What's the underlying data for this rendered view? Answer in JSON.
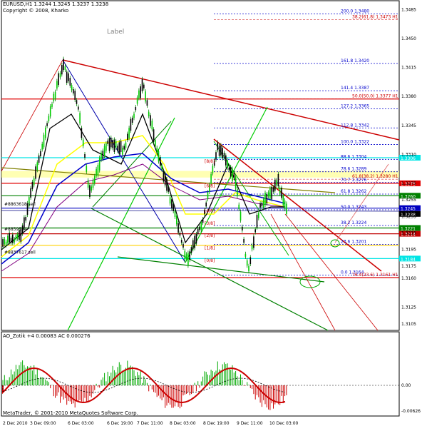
{
  "header": {
    "symbol_line": "EURUSD,H1  1.3244 1.3245 1.3237 1.3238",
    "copyright": "Copyright © 2008, Kharko"
  },
  "label": "Label",
  "fib_levels": [
    {
      "label": "200.0  1.3480",
      "price": 1.348,
      "color": "#0000cc"
    },
    {
      "label": "161.8  1.3420",
      "price": 1.342,
      "color": "#0000cc"
    },
    {
      "label": "141.4  1.3387",
      "price": 1.3387,
      "color": "#0000cc"
    },
    {
      "label": "127.2  1.3365",
      "price": 1.3365,
      "color": "#0000cc"
    },
    {
      "label": "112.8  1.3342",
      "price": 1.3342,
      "color": "#0000cc"
    },
    {
      "label": "100.0  1.3322",
      "price": 1.3322,
      "color": "#0000cc"
    },
    {
      "label": "88.6  1.3304",
      "price": 1.3304,
      "color": "#0000cc"
    },
    {
      "label": "78.6  1.3289",
      "price": 1.3289,
      "color": "#0000cc"
    },
    {
      "label": "70.7  1.3276",
      "price": 1.3276,
      "color": "#0000cc"
    },
    {
      "label": "61.8  1.3262",
      "price": 1.3262,
      "color": "#0000cc"
    },
    {
      "label": "50.0  1.3243",
      "price": 1.3243,
      "color": "#0000cc"
    },
    {
      "label": "38.2  1.3224",
      "price": 1.3224,
      "color": "#0000cc"
    },
    {
      "label": "23.6  1.3201",
      "price": 1.3201,
      "color": "#0000cc"
    },
    {
      "label": "0.0  1.3164",
      "price": 1.3164,
      "color": "#0000cc"
    }
  ],
  "red_fib_labels": [
    {
      "label": "38.2(61.8)  1.3473 H1",
      "price": 1.3473
    },
    {
      "label": "50.0(50.0)  1.3377 H1",
      "price": 1.3377
    },
    {
      "label": "61.8(38.2)  1.3280 H1",
      "price": 1.328
    },
    {
      "label": "76.4(23.6)  1.3161 H1",
      "price": 1.3161
    }
  ],
  "right_price_boxes": [
    {
      "text": "1.3306",
      "price": 1.3306,
      "bg": "#00e5e5",
      "fg": "#ffffff"
    },
    {
      "text": "1.3275",
      "price": 1.3275,
      "bg": "#e00000",
      "fg": "#ffffff"
    },
    {
      "text": "1.3260",
      "price": 1.326,
      "bg": "#008000",
      "fg": "#ffffff"
    },
    {
      "text": "1.3245",
      "price": 1.3245,
      "bg": "#0000c0",
      "fg": "#ffffff"
    },
    {
      "text": "1.3238",
      "price": 1.3238,
      "bg": "#000000",
      "fg": "#ffffff"
    },
    {
      "text": "1.3221",
      "price": 1.3221,
      "bg": "#008000",
      "fg": "#ffffff"
    },
    {
      "text": "1.3214",
      "price": 1.3214,
      "bg": "#c00000",
      "fg": "#ffffff"
    },
    {
      "text": "1.3184",
      "price": 1.3184,
      "bg": "#00e5e5",
      "fg": "#ffffff"
    }
  ],
  "price_axis": [
    "1.3485",
    "1.3450",
    "1.3415",
    "1.3380",
    "1.3345",
    "1.3310",
    "1.3275",
    "1.3255",
    "1.3235",
    "1.3215",
    "1.3195",
    "1.3175",
    "1.3160",
    "1.3125",
    "1.3105"
  ],
  "trade_labels": [
    {
      "text": "#8863618 sell",
      "price": 1.3248
    },
    {
      "text": "#8859594",
      "price": 1.3218
    },
    {
      "text": "#8837617 sell",
      "price": 1.319
    }
  ],
  "octave_labels": [
    {
      "text": "[8/8]",
      "price": 1.33
    },
    {
      "text": "[6/8]",
      "price": 1.327
    },
    {
      "text": "[4/8]",
      "price": 1.324
    },
    {
      "text": "[3/8]",
      "price": 1.3225
    },
    {
      "text": "[2/8]",
      "price": 1.321
    },
    {
      "text": "[1/8]",
      "price": 1.3195
    },
    {
      "text": "[0/8]",
      "price": 1.318
    }
  ],
  "indicator": {
    "title": "AO_Zotik +4  0.00083  AC  0.000276",
    "axis": [
      "0.00",
      "-0.00626"
    ]
  },
  "time_axis": [
    "2 Dec 2010",
    "3 Dec 09:00",
    "6 Dec 03:00",
    "6 Dec 19:00",
    "7 Dec 11:00",
    "8 Dec 03:00",
    "8 Dec 19:00",
    "9 Dec 11:00",
    "10 Dec 03:00"
  ],
  "footer": {
    "copyright": "MetaTrader, © 2001-2010 MetaQuotes Software Corp."
  },
  "colors": {
    "fib_blue": "#0000cc",
    "red_line": "#cc0000",
    "cyan": "#00e5e5",
    "yellow": "#ffff00",
    "green": "#00cc00",
    "navy": "#000080",
    "olive": "#808000"
  }
}
